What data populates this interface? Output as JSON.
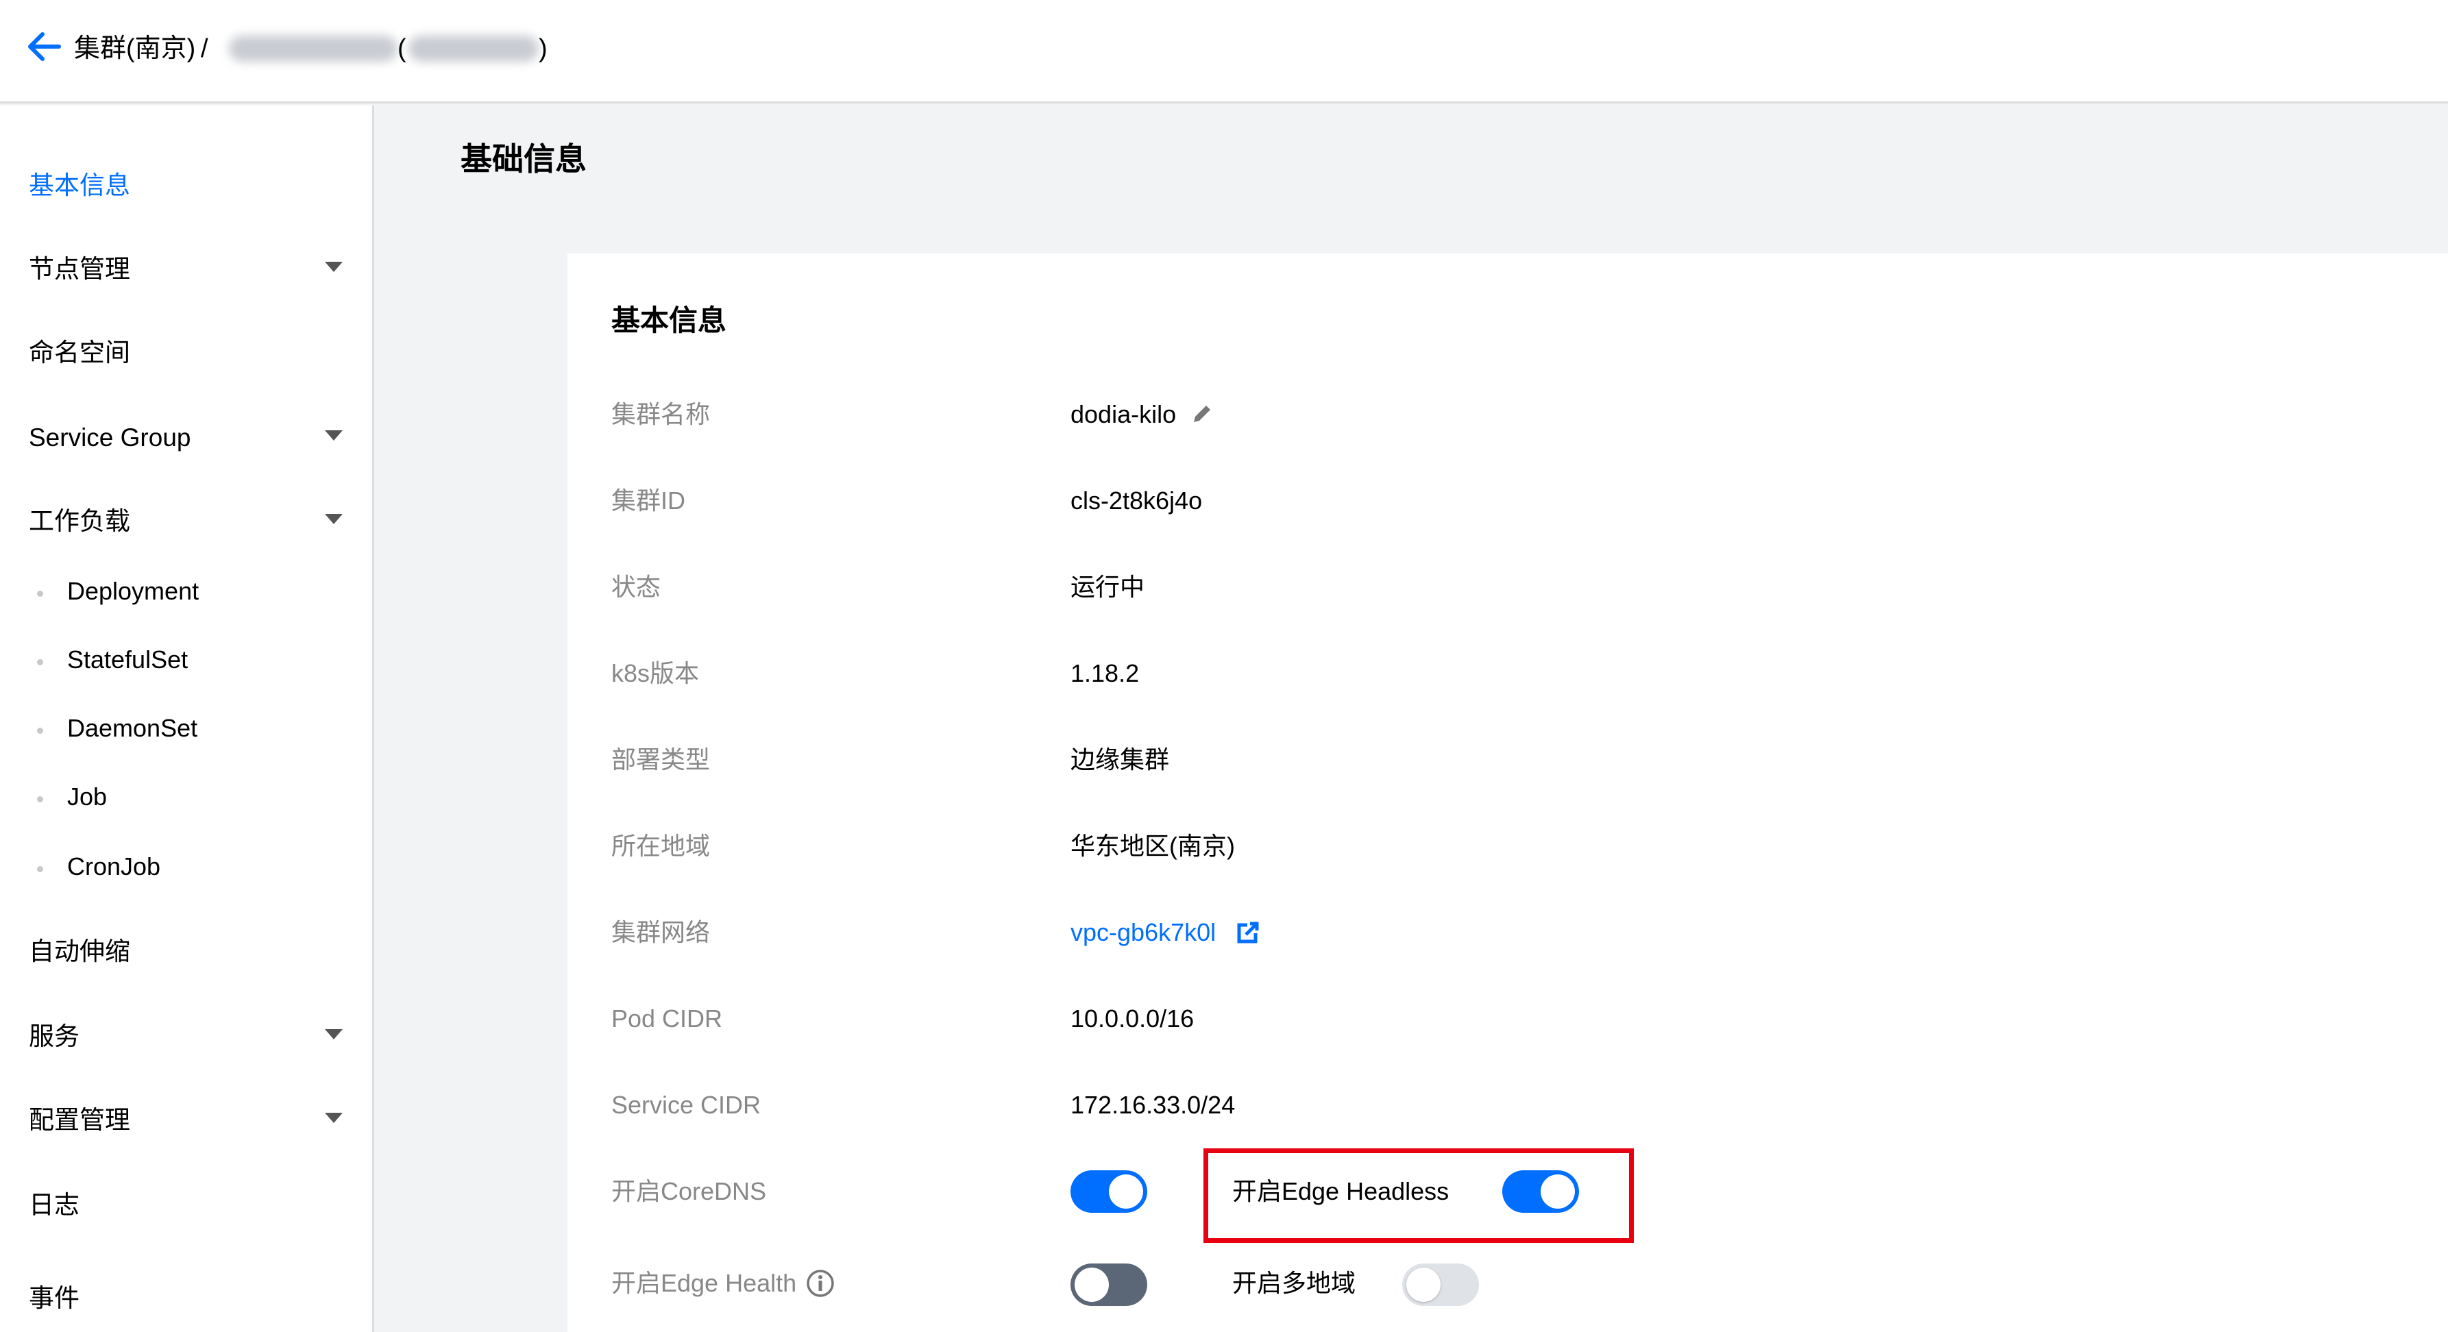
{
  "breadcrumb": {
    "cluster_region": "集群(南京)",
    "separator": "/",
    "paren_open": "(",
    "paren_close": ")"
  },
  "sidebar": {
    "items": [
      {
        "label": "基本信息"
      },
      {
        "label": "节点管理"
      },
      {
        "label": "命名空间"
      },
      {
        "label": "Service Group"
      },
      {
        "label": "工作负载"
      },
      {
        "label": "自动伸缩"
      },
      {
        "label": "服务"
      },
      {
        "label": "配置管理"
      },
      {
        "label": "日志"
      },
      {
        "label": "事件"
      }
    ],
    "workload_sub": [
      {
        "label": "Deployment"
      },
      {
        "label": "StatefulSet"
      },
      {
        "label": "DaemonSet"
      },
      {
        "label": "Job"
      },
      {
        "label": "CronJob"
      }
    ]
  },
  "page": {
    "title": "基础信息"
  },
  "card": {
    "title": "基本信息",
    "rows": [
      {
        "label": "集群名称",
        "value": "dodia-kilo"
      },
      {
        "label": "集群ID",
        "value": "cls-2t8k6j4o"
      },
      {
        "label": "状态",
        "value": "运行中"
      },
      {
        "label": "k8s版本",
        "value": "1.18.2"
      },
      {
        "label": "部署类型",
        "value": "边缘集群"
      },
      {
        "label": "所在地域",
        "value": "华东地区(南京)"
      },
      {
        "label": "集群网络",
        "value": "vpc-gb6k7k0l"
      },
      {
        "label": "Pod CIDR",
        "value": "10.0.0.0/16"
      },
      {
        "label": "Service CIDR",
        "value": "172.16.33.0/24"
      }
    ],
    "coredns_label": "开启CoreDNS",
    "edge_headless_label": "开启Edge Headless",
    "edge_health_label": "开启Edge Health",
    "multi_region_label": "开启多地域",
    "toggles": {
      "coredns": true,
      "edge_headless": true,
      "edge_health": false,
      "multi_region": false
    }
  },
  "colors": {
    "accent": "#006eff",
    "highlight": "#e60012",
    "label_gray": "#888888"
  }
}
